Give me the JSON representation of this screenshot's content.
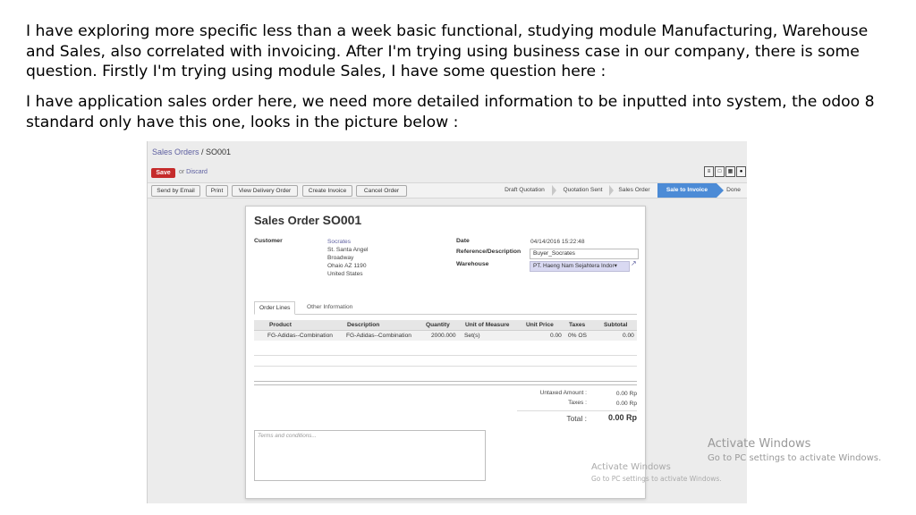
{
  "paragraphs": {
    "p1": "I have exploring more specific less than a week basic functional, studying module Manufacturing, Warehouse and Sales, also correlated with invoicing. After I'm trying using business case in our company, there is some question. Firstly I'm trying using module Sales, I have some question here :",
    "p2": "I have application sales order here, we need more detailed information to be inputted into system, the odoo 8 standard only have this one, looks in the picture below :"
  },
  "screenshot": {
    "breadcrumb": {
      "parent": "Sales Orders",
      "sep": " / ",
      "current": "SO001"
    },
    "save_label": "Save",
    "or_text": "or ",
    "discard_label": "Discard",
    "toolbar_buttons": [
      "Send by Email",
      "Print",
      "View Delivery Order",
      "Create Invoice",
      "Cancel Order"
    ],
    "stages": [
      "Draft Quotation",
      "Quotation Sent",
      "Sales Order",
      "Sale to Invoice",
      "Done"
    ],
    "active_stage": "Sale to Invoice",
    "form": {
      "title_prefix": "Sales Order ",
      "number": "SO001",
      "customer_label": "Customer",
      "customer_name": "Socrates",
      "customer_address": [
        "St. Santa Angel",
        "Broadway",
        "Ohaio AZ 1190",
        "United States"
      ],
      "date_label": "Date",
      "date_value": "04/14/2016 15:22:48",
      "ref_label": "Reference/Description",
      "ref_value": "Buyer_Socrates",
      "warehouse_label": "Warehouse",
      "warehouse_value": "PT. Haeng Nam Sejahtera Indor▾",
      "tabs": [
        "Order Lines",
        "Other Information"
      ],
      "columns": [
        "Product",
        "Description",
        "Quantity",
        "Unit of Measure",
        "Unit Price",
        "Taxes",
        "Subtotal"
      ],
      "rows": [
        {
          "product": "FG-Adidas--Combination",
          "description": "FG-Adidas--Combination",
          "quantity": "2000.000",
          "uom": "Set(s)",
          "unit_price": "0.00",
          "taxes": "0% OS",
          "subtotal": "0.00"
        }
      ],
      "untaxed_label": "Untaxed Amount :",
      "untaxed_value": "0.00 Rp",
      "taxes_label": "Taxes :",
      "taxes_value": "0.00 Rp",
      "total_label": "Total :",
      "total_value": "0.00 Rp",
      "terms_placeholder": "Terms and conditions..."
    },
    "watermark_small": {
      "title": "Activate Windows",
      "sub": "Go to PC settings to activate Windows."
    }
  },
  "watermark": {
    "title": "Activate Windows",
    "sub": "Go to PC settings to activate Windows."
  },
  "colors": {
    "save": "#c52b2b",
    "active_stage": "#4c8bd6",
    "link": "#5d5fa0"
  }
}
